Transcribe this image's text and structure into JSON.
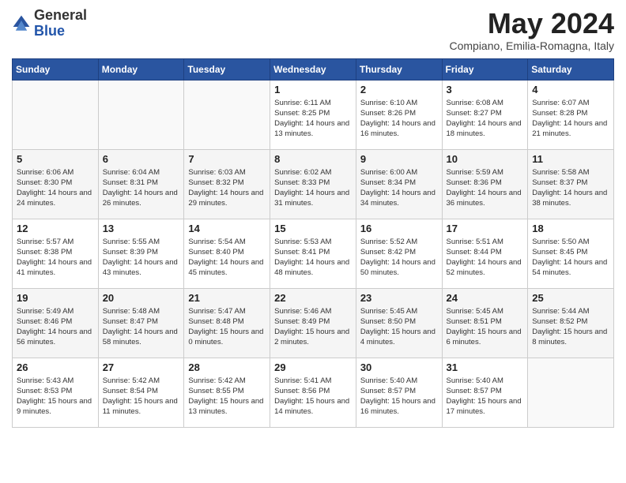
{
  "logo": {
    "general": "General",
    "blue": "Blue"
  },
  "header": {
    "month_title": "May 2024",
    "location": "Compiano, Emilia-Romagna, Italy"
  },
  "weekdays": [
    "Sunday",
    "Monday",
    "Tuesday",
    "Wednesday",
    "Thursday",
    "Friday",
    "Saturday"
  ],
  "weeks": [
    [
      {
        "day": "",
        "sunrise": "",
        "sunset": "",
        "daylight": ""
      },
      {
        "day": "",
        "sunrise": "",
        "sunset": "",
        "daylight": ""
      },
      {
        "day": "",
        "sunrise": "",
        "sunset": "",
        "daylight": ""
      },
      {
        "day": "1",
        "sunrise": "Sunrise: 6:11 AM",
        "sunset": "Sunset: 8:25 PM",
        "daylight": "Daylight: 14 hours and 13 minutes."
      },
      {
        "day": "2",
        "sunrise": "Sunrise: 6:10 AM",
        "sunset": "Sunset: 8:26 PM",
        "daylight": "Daylight: 14 hours and 16 minutes."
      },
      {
        "day": "3",
        "sunrise": "Sunrise: 6:08 AM",
        "sunset": "Sunset: 8:27 PM",
        "daylight": "Daylight: 14 hours and 18 minutes."
      },
      {
        "day": "4",
        "sunrise": "Sunrise: 6:07 AM",
        "sunset": "Sunset: 8:28 PM",
        "daylight": "Daylight: 14 hours and 21 minutes."
      }
    ],
    [
      {
        "day": "5",
        "sunrise": "Sunrise: 6:06 AM",
        "sunset": "Sunset: 8:30 PM",
        "daylight": "Daylight: 14 hours and 24 minutes."
      },
      {
        "day": "6",
        "sunrise": "Sunrise: 6:04 AM",
        "sunset": "Sunset: 8:31 PM",
        "daylight": "Daylight: 14 hours and 26 minutes."
      },
      {
        "day": "7",
        "sunrise": "Sunrise: 6:03 AM",
        "sunset": "Sunset: 8:32 PM",
        "daylight": "Daylight: 14 hours and 29 minutes."
      },
      {
        "day": "8",
        "sunrise": "Sunrise: 6:02 AM",
        "sunset": "Sunset: 8:33 PM",
        "daylight": "Daylight: 14 hours and 31 minutes."
      },
      {
        "day": "9",
        "sunrise": "Sunrise: 6:00 AM",
        "sunset": "Sunset: 8:34 PM",
        "daylight": "Daylight: 14 hours and 34 minutes."
      },
      {
        "day": "10",
        "sunrise": "Sunrise: 5:59 AM",
        "sunset": "Sunset: 8:36 PM",
        "daylight": "Daylight: 14 hours and 36 minutes."
      },
      {
        "day": "11",
        "sunrise": "Sunrise: 5:58 AM",
        "sunset": "Sunset: 8:37 PM",
        "daylight": "Daylight: 14 hours and 38 minutes."
      }
    ],
    [
      {
        "day": "12",
        "sunrise": "Sunrise: 5:57 AM",
        "sunset": "Sunset: 8:38 PM",
        "daylight": "Daylight: 14 hours and 41 minutes."
      },
      {
        "day": "13",
        "sunrise": "Sunrise: 5:55 AM",
        "sunset": "Sunset: 8:39 PM",
        "daylight": "Daylight: 14 hours and 43 minutes."
      },
      {
        "day": "14",
        "sunrise": "Sunrise: 5:54 AM",
        "sunset": "Sunset: 8:40 PM",
        "daylight": "Daylight: 14 hours and 45 minutes."
      },
      {
        "day": "15",
        "sunrise": "Sunrise: 5:53 AM",
        "sunset": "Sunset: 8:41 PM",
        "daylight": "Daylight: 14 hours and 48 minutes."
      },
      {
        "day": "16",
        "sunrise": "Sunrise: 5:52 AM",
        "sunset": "Sunset: 8:42 PM",
        "daylight": "Daylight: 14 hours and 50 minutes."
      },
      {
        "day": "17",
        "sunrise": "Sunrise: 5:51 AM",
        "sunset": "Sunset: 8:44 PM",
        "daylight": "Daylight: 14 hours and 52 minutes."
      },
      {
        "day": "18",
        "sunrise": "Sunrise: 5:50 AM",
        "sunset": "Sunset: 8:45 PM",
        "daylight": "Daylight: 14 hours and 54 minutes."
      }
    ],
    [
      {
        "day": "19",
        "sunrise": "Sunrise: 5:49 AM",
        "sunset": "Sunset: 8:46 PM",
        "daylight": "Daylight: 14 hours and 56 minutes."
      },
      {
        "day": "20",
        "sunrise": "Sunrise: 5:48 AM",
        "sunset": "Sunset: 8:47 PM",
        "daylight": "Daylight: 14 hours and 58 minutes."
      },
      {
        "day": "21",
        "sunrise": "Sunrise: 5:47 AM",
        "sunset": "Sunset: 8:48 PM",
        "daylight": "Daylight: 15 hours and 0 minutes."
      },
      {
        "day": "22",
        "sunrise": "Sunrise: 5:46 AM",
        "sunset": "Sunset: 8:49 PM",
        "daylight": "Daylight: 15 hours and 2 minutes."
      },
      {
        "day": "23",
        "sunrise": "Sunrise: 5:45 AM",
        "sunset": "Sunset: 8:50 PM",
        "daylight": "Daylight: 15 hours and 4 minutes."
      },
      {
        "day": "24",
        "sunrise": "Sunrise: 5:45 AM",
        "sunset": "Sunset: 8:51 PM",
        "daylight": "Daylight: 15 hours and 6 minutes."
      },
      {
        "day": "25",
        "sunrise": "Sunrise: 5:44 AM",
        "sunset": "Sunset: 8:52 PM",
        "daylight": "Daylight: 15 hours and 8 minutes."
      }
    ],
    [
      {
        "day": "26",
        "sunrise": "Sunrise: 5:43 AM",
        "sunset": "Sunset: 8:53 PM",
        "daylight": "Daylight: 15 hours and 9 minutes."
      },
      {
        "day": "27",
        "sunrise": "Sunrise: 5:42 AM",
        "sunset": "Sunset: 8:54 PM",
        "daylight": "Daylight: 15 hours and 11 minutes."
      },
      {
        "day": "28",
        "sunrise": "Sunrise: 5:42 AM",
        "sunset": "Sunset: 8:55 PM",
        "daylight": "Daylight: 15 hours and 13 minutes."
      },
      {
        "day": "29",
        "sunrise": "Sunrise: 5:41 AM",
        "sunset": "Sunset: 8:56 PM",
        "daylight": "Daylight: 15 hours and 14 minutes."
      },
      {
        "day": "30",
        "sunrise": "Sunrise: 5:40 AM",
        "sunset": "Sunset: 8:57 PM",
        "daylight": "Daylight: 15 hours and 16 minutes."
      },
      {
        "day": "31",
        "sunrise": "Sunrise: 5:40 AM",
        "sunset": "Sunset: 8:57 PM",
        "daylight": "Daylight: 15 hours and 17 minutes."
      },
      {
        "day": "",
        "sunrise": "",
        "sunset": "",
        "daylight": ""
      }
    ]
  ]
}
